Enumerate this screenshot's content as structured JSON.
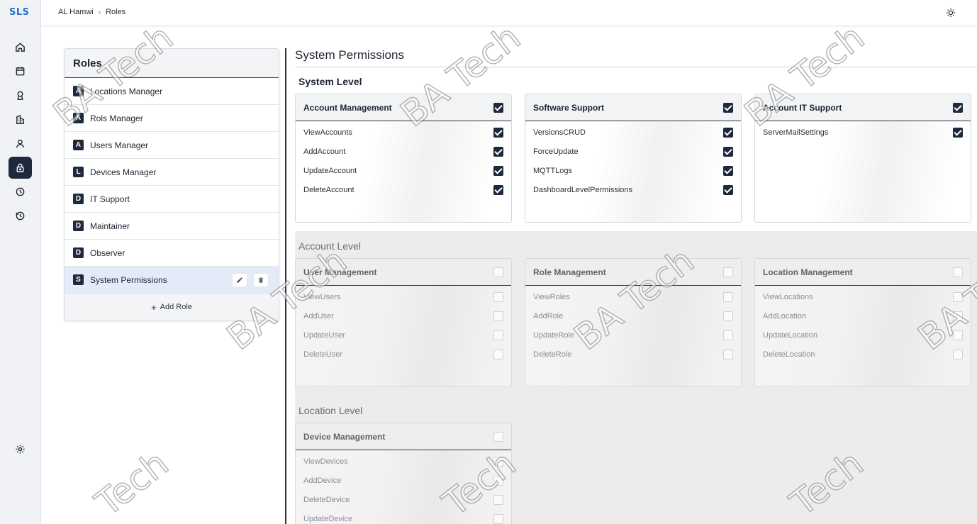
{
  "app": {
    "logo": "SLS"
  },
  "topbar": {
    "breadcrumb": [
      "AL Hamwi",
      "Roles"
    ],
    "theme_icon": "sun-icon"
  },
  "rail": {
    "items": [
      "home-icon",
      "calendar-icon",
      "location-pin-icon",
      "building-icon",
      "user-icon",
      "lock-icon",
      "history-icon",
      "history-alt-icon"
    ],
    "active": "lock-icon",
    "bottom": "gear-icon"
  },
  "roles": {
    "title": "Roles",
    "items": [
      {
        "letter": "A",
        "name": "Locations Manager"
      },
      {
        "letter": "A",
        "name": "Rols Manager"
      },
      {
        "letter": "A",
        "name": "Users Manager"
      },
      {
        "letter": "L",
        "name": "Devices Manager"
      },
      {
        "letter": "D",
        "name": "IT Support"
      },
      {
        "letter": "D",
        "name": "Maintainer"
      },
      {
        "letter": "D",
        "name": "Observer"
      },
      {
        "letter": "S",
        "name": "System Permissions"
      }
    ],
    "selected": "System Permissions",
    "add_label": "Add Role",
    "add_symbol": "+"
  },
  "content": {
    "title": "System Permissions",
    "system_level": {
      "title": "System Level",
      "cards": [
        {
          "title": "Account Management",
          "checked": true,
          "perms": [
            {
              "name": "ViewAccounts",
              "checked": true
            },
            {
              "name": "AddAccount",
              "checked": true
            },
            {
              "name": "UpdateAccount",
              "checked": true
            },
            {
              "name": "DeleteAccount",
              "checked": true
            }
          ]
        },
        {
          "title": "Software Support",
          "checked": true,
          "perms": [
            {
              "name": "VersionsCRUD",
              "checked": true
            },
            {
              "name": "ForceUpdate",
              "checked": true
            },
            {
              "name": "MQTTLogs",
              "checked": true
            },
            {
              "name": "DashboardLevelPermissions",
              "checked": true
            }
          ]
        },
        {
          "title": "Account IT Support",
          "checked": true,
          "perms": [
            {
              "name": "ServerMailSettings",
              "checked": true
            }
          ]
        }
      ]
    },
    "account_level": {
      "title": "Account Level",
      "cards": [
        {
          "title": "User Management",
          "checked": false,
          "perms": [
            {
              "name": "ViewUsers",
              "checked": false
            },
            {
              "name": "AddUser",
              "checked": false
            },
            {
              "name": "UpdateUser",
              "checked": false
            },
            {
              "name": "DeleteUser",
              "checked": false
            }
          ]
        },
        {
          "title": "Role Management",
          "checked": false,
          "perms": [
            {
              "name": "ViewRoles",
              "checked": false
            },
            {
              "name": "AddRole",
              "checked": false
            },
            {
              "name": "UpdateRole",
              "checked": false
            },
            {
              "name": "DeleteRole",
              "checked": false
            }
          ]
        },
        {
          "title": "Location Management",
          "checked": false,
          "perms": [
            {
              "name": "ViewLocations",
              "checked": false
            },
            {
              "name": "AddLocation",
              "checked": false
            },
            {
              "name": "UpdateLocation",
              "checked": false
            },
            {
              "name": "DeleteLocation",
              "checked": false
            }
          ]
        }
      ]
    },
    "location_level": {
      "title": "Location Level",
      "cards": [
        {
          "title": "Device Management",
          "checked": false,
          "perms": [
            {
              "name": "ViewDevices",
              "checked": false
            },
            {
              "name": "AddDevice",
              "checked": false
            },
            {
              "name": "DeleteDevice",
              "checked": false
            },
            {
              "name": "UpdateDevice",
              "checked": false
            }
          ]
        }
      ]
    }
  },
  "watermark": "BA Tech",
  "watermark_partial": "Tech"
}
